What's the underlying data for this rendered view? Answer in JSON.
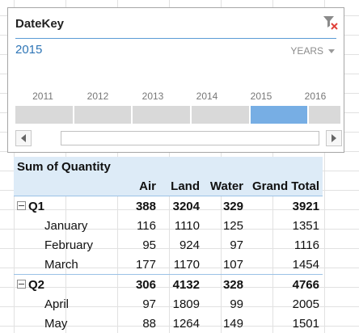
{
  "slicer": {
    "title": "DateKey",
    "selected_label": "2015",
    "level_label": "YEARS",
    "years": [
      "2011",
      "2012",
      "2013",
      "2014",
      "2015",
      "2016"
    ],
    "selected_year": "2015"
  },
  "pivot": {
    "title": "Sum of Quantity",
    "columns": [
      "Air",
      "Land",
      "Water",
      "Grand Total"
    ],
    "rows": [
      {
        "label": "Q1",
        "type": "quarter",
        "values": [
          "388",
          "3204",
          "329",
          "3921"
        ]
      },
      {
        "label": "January",
        "type": "month",
        "values": [
          "116",
          "1110",
          "125",
          "1351"
        ]
      },
      {
        "label": "February",
        "type": "month",
        "values": [
          "95",
          "924",
          "97",
          "1116"
        ]
      },
      {
        "label": "March",
        "type": "month",
        "values": [
          "177",
          "1170",
          "107",
          "1454"
        ]
      },
      {
        "label": "Q2",
        "type": "quarter",
        "values": [
          "306",
          "4132",
          "328",
          "4766"
        ]
      },
      {
        "label": "April",
        "type": "month",
        "values": [
          "97",
          "1809",
          "99",
          "2005"
        ]
      },
      {
        "label": "May",
        "type": "month",
        "values": [
          "88",
          "1264",
          "149",
          "1501"
        ]
      }
    ]
  },
  "colors": {
    "accent": "#2e75b6",
    "selection": "#77aee4",
    "header_fill": "#ddebf7"
  }
}
